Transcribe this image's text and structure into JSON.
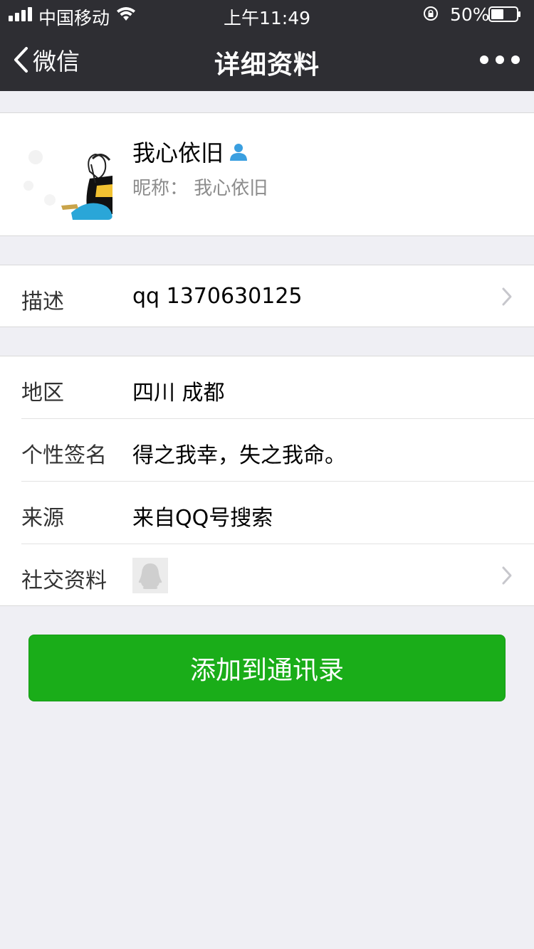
{
  "status_bar": {
    "carrier": "中国移动",
    "time": "上午11:49",
    "battery_percent": "50%",
    "battery_level": 0.5
  },
  "nav": {
    "back_label": "微信",
    "title": "详细资料"
  },
  "profile": {
    "name": "我心依旧",
    "nickname": "昵称：  我心依旧",
    "gender_icon": "male-user-icon",
    "accent_color": "#3a9fe0"
  },
  "description": {
    "label": "描述",
    "value": "qq 1370630125"
  },
  "info_rows": [
    {
      "label": "地区",
      "value": "四川 成都"
    },
    {
      "label": "个性签名",
      "value": "得之我幸，失之我命。"
    },
    {
      "label": "来源",
      "value": "来自QQ号搜索"
    },
    {
      "label": "社交资料",
      "value": ""
    }
  ],
  "add_button": {
    "label": "添加到通讯录",
    "color": "#1aad19"
  },
  "colors": {
    "nav_background": "#2e2e33",
    "page_background": "#efeff4"
  }
}
